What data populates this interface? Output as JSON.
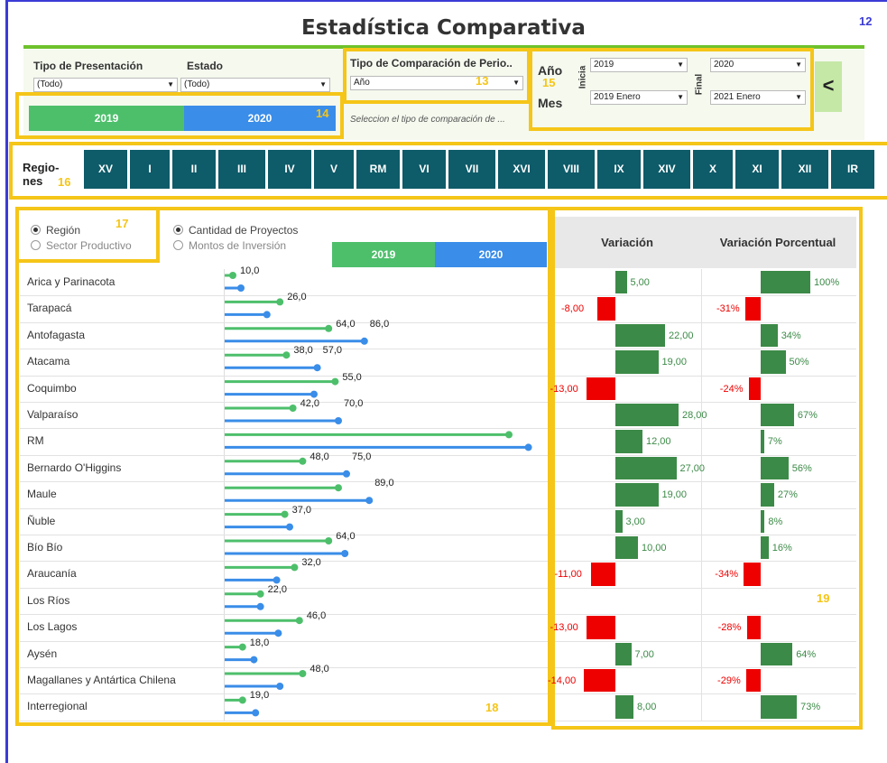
{
  "header": {
    "title": "Estadística Comparativa",
    "badge": "12"
  },
  "filters": {
    "tipo_presentacion": {
      "label": "Tipo de Presentación",
      "value": "(Todo)"
    },
    "estado": {
      "label": "Estado",
      "value": "(Todo)"
    },
    "tipo_comparacion": {
      "label": "Tipo de Comparación de Perio..",
      "value": "Año"
    },
    "hint": "Seleccion el tipo de comparación de ...",
    "anio_label": "Año",
    "mes_label": "Mes",
    "inicia_label": "Inicia",
    "final_label": "Final",
    "anio_inicia": "2019",
    "anio_final": "2020",
    "mes_inicia": "2019 Enero",
    "mes_final": "2021 Enero",
    "prev_icon": "<"
  },
  "years": {
    "y1": "2019",
    "y2": "2020"
  },
  "annotations": {
    "n12": "12",
    "n13": "13",
    "n14": "14",
    "n15": "15",
    "n16": "16",
    "n17": "17",
    "n18": "18",
    "n19": "19"
  },
  "regions_tabs": {
    "label1": "Regio-",
    "label2": "nes",
    "tabs": [
      "XV",
      "I",
      "II",
      "III",
      "IV",
      "V",
      "RM",
      "VI",
      "VII",
      "XVI",
      "VIII",
      "IX",
      "XIV",
      "X",
      "XI",
      "XII",
      "IR"
    ]
  },
  "options": {
    "region": "Región",
    "sector": "Sector Productivo",
    "cantidad": "Cantidad de Proyectos",
    "montos": "Montos de Inversión"
  },
  "table": {
    "variacion": "Variación",
    "variacion_pct": "Variación Porcentual"
  },
  "colors": {
    "y2019": "#4dbf6b",
    "y2020": "#3a8de8",
    "pos": "#3c8a47",
    "neg": "#e00000",
    "tabs": "#0e5b69"
  },
  "chart_data": {
    "type": "bar",
    "categories": [
      "Arica y Parinacota",
      "Tarapacá",
      "Antofagasta",
      "Atacama",
      "Coquimbo",
      "Valparaíso",
      "RM",
      "Bernardo O'Higgins",
      "Maule",
      "Ñuble",
      "Bío Bío",
      "Araucanía",
      "Los Ríos",
      "Los Lagos",
      "Aysén",
      "Magallanes y Antártica Chilena",
      "Interregional"
    ],
    "series": [
      {
        "name": "2019",
        "values": [
          5,
          34,
          64,
          38,
          68,
          42,
          175,
          48,
          70,
          37,
          64,
          43,
          22,
          46,
          11,
          48,
          11
        ]
      },
      {
        "name": "2020",
        "values": [
          10,
          26,
          86,
          57,
          55,
          70,
          187,
          75,
          89,
          40,
          74,
          32,
          22,
          33,
          18,
          34,
          19
        ]
      }
    ],
    "labels": [
      [
        "10,0",
        ""
      ],
      [
        "26,0",
        ""
      ],
      [
        "64,0",
        "86,0"
      ],
      [
        "38,0",
        "57,0"
      ],
      [
        "55,0",
        ""
      ],
      [
        "42,0",
        "70,0"
      ],
      [
        "",
        ""
      ],
      [
        "48,0",
        "75,0"
      ],
      [
        "",
        "89,0"
      ],
      [
        "37,0",
        ""
      ],
      [
        "64,0",
        ""
      ],
      [
        "32,0",
        ""
      ],
      [
        "22,0",
        ""
      ],
      [
        "46,0",
        ""
      ],
      [
        "18,0",
        ""
      ],
      [
        "48,0",
        ""
      ],
      [
        "19,0",
        ""
      ]
    ],
    "variacion": [
      5,
      -8,
      22,
      19,
      -13,
      28,
      12,
      27,
      19,
      3,
      10,
      -11,
      null,
      -13,
      7,
      -14,
      8
    ],
    "variacion_txt": [
      "5,00",
      "-8,00",
      "22,00",
      "19,00",
      "-13,00",
      "28,00",
      "12,00",
      "27,00",
      "19,00",
      "3,00",
      "10,00",
      "-11,00",
      "",
      "-13,00",
      "7,00",
      "-14,00",
      "8,00"
    ],
    "variacion_pct": [
      100,
      -31,
      34,
      50,
      -24,
      67,
      7,
      56,
      27,
      8,
      16,
      -34,
      null,
      -28,
      64,
      -29,
      73
    ],
    "variacion_pct_txt": [
      "100%",
      "-31%",
      "34%",
      "50%",
      "-24%",
      "67%",
      "7%",
      "56%",
      "27%",
      "8%",
      "16%",
      "-34%",
      "",
      "-28%",
      "64%",
      "-29%",
      "73%"
    ]
  }
}
